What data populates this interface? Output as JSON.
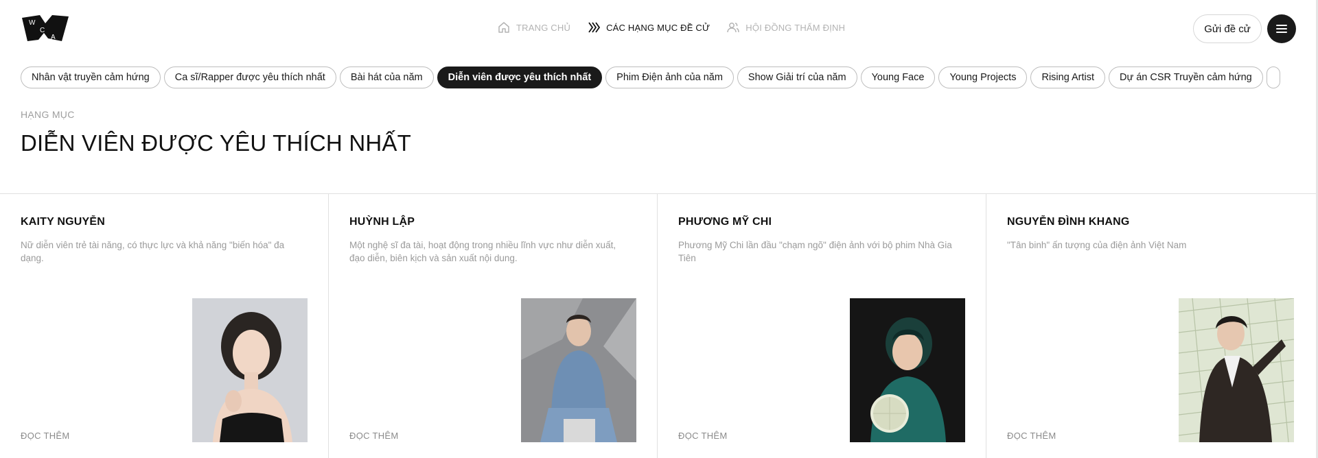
{
  "logo": {
    "letters": [
      "W",
      "C",
      "A"
    ]
  },
  "nav": [
    {
      "label": "TRANG CHỦ",
      "icon": "home-icon",
      "active": false
    },
    {
      "label": "CÁC HẠNG MỤC ĐỀ CỬ",
      "icon": "categories-icon",
      "active": true
    },
    {
      "label": "HỘI ĐỒNG THẨM ĐỊNH",
      "icon": "users-icon",
      "active": false
    }
  ],
  "header": {
    "send_label": "Gửi đề cử",
    "menu_icon": "hamburger-icon"
  },
  "categories": [
    "Nhân vật truyền cảm hứng",
    "Ca sĩ/Rapper được yêu thích nhất",
    "Bài hát của năm",
    "Diễn viên được yêu thích nhất",
    "Phim Điện ảnh của năm",
    "Show Giải trí của năm",
    "Young Face",
    "Young Projects",
    "Rising Artist",
    "Dự án CSR Truyền cảm hứng"
  ],
  "active_category_index": 3,
  "section": {
    "eyebrow": "HẠNG MỤC",
    "title": "DIỄN VIÊN ĐƯỢC YÊU THÍCH NHẤT"
  },
  "nominees": [
    {
      "name": "KAITY NGUYỄN",
      "description": "Nữ diễn viên trẻ tài năng, có thực lực và khả năng \"biến hóa\" đa dạng.",
      "more": "ĐỌC THÊM"
    },
    {
      "name": "HUỲNH LẬP",
      "description": "Một nghệ sĩ đa tài, hoạt động trong nhiều lĩnh vực như diễn xuất, đạo diễn, biên kịch và sản xuất nội dung.",
      "more": "ĐỌC THÊM"
    },
    {
      "name": "PHƯƠNG MỸ CHI",
      "description": "Phương Mỹ Chi lần đầu \"chạm ngõ\" điện ảnh với bộ phim Nhà Gia Tiên",
      "more": "ĐỌC THÊM"
    },
    {
      "name": "NGUYỄN ĐÌNH KHANG",
      "description": "\"Tân binh\" ấn tượng của điện ảnh Việt Nam",
      "more": "ĐỌC THÊM"
    }
  ],
  "colors": {
    "primary": "#1a1a1a",
    "muted_text": "#9a9a9a",
    "border": "#e0e0e0"
  }
}
